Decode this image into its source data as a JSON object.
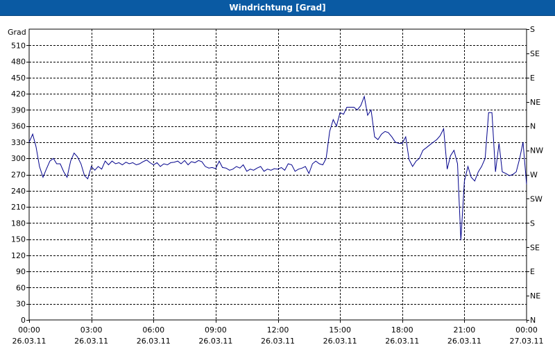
{
  "window": {
    "title": "Windrichtung [Grad]"
  },
  "chart_data": {
    "type": "line",
    "title": "Windrichtung [Grad]",
    "ylabel": "Grad",
    "xlabel": "",
    "ylim": [
      0,
      540
    ],
    "xlim": [
      0,
      24
    ],
    "grid": true,
    "y_ticks": [
      0,
      30,
      60,
      90,
      120,
      150,
      180,
      210,
      240,
      270,
      300,
      330,
      360,
      390,
      420,
      450,
      480,
      510
    ],
    "right_ticks": [
      {
        "value": 0,
        "label": "N"
      },
      {
        "value": 45,
        "label": "NE"
      },
      {
        "value": 90,
        "label": "E"
      },
      {
        "value": 135,
        "label": "SE"
      },
      {
        "value": 180,
        "label": "S"
      },
      {
        "value": 225,
        "label": "SW"
      },
      {
        "value": 270,
        "label": "W"
      },
      {
        "value": 315,
        "label": "NW"
      },
      {
        "value": 360,
        "label": "N"
      },
      {
        "value": 405,
        "label": "NE"
      },
      {
        "value": 450,
        "label": "E"
      },
      {
        "value": 495,
        "label": "SE"
      },
      {
        "value": 540,
        "label": "S"
      }
    ],
    "x_ticks": [
      {
        "value": 0,
        "time": "00:00",
        "date": "26.03.11"
      },
      {
        "value": 3,
        "time": "03:00",
        "date": "26.03.11"
      },
      {
        "value": 6,
        "time": "06:00",
        "date": "26.03.11"
      },
      {
        "value": 9,
        "time": "09:00",
        "date": "26.03.11"
      },
      {
        "value": 12,
        "time": "12:00",
        "date": "26.03.11"
      },
      {
        "value": 15,
        "time": "15:00",
        "date": "26.03.11"
      },
      {
        "value": 18,
        "time": "18:00",
        "date": "26.03.11"
      },
      {
        "value": 21,
        "time": "21:00",
        "date": "26.03.11"
      },
      {
        "value": 24,
        "time": "00:00",
        "date": "27.03.11"
      }
    ],
    "series": [
      {
        "color": "#00008b",
        "x": [
          0,
          0.17,
          0.33,
          0.5,
          0.67,
          0.83,
          1,
          1.17,
          1.33,
          1.5,
          1.67,
          1.83,
          2,
          2.17,
          2.33,
          2.5,
          2.67,
          2.83,
          3,
          3.17,
          3.33,
          3.5,
          3.67,
          3.83,
          4,
          4.17,
          4.33,
          4.5,
          4.67,
          4.83,
          5,
          5.17,
          5.33,
          5.5,
          5.67,
          5.83,
          6,
          6.17,
          6.33,
          6.5,
          6.67,
          6.83,
          7,
          7.17,
          7.33,
          7.5,
          7.67,
          7.83,
          8,
          8.17,
          8.33,
          8.5,
          8.67,
          8.83,
          9,
          9.17,
          9.33,
          9.5,
          9.67,
          9.83,
          10,
          10.17,
          10.33,
          10.5,
          10.67,
          10.83,
          11,
          11.17,
          11.33,
          11.5,
          11.67,
          11.83,
          12,
          12.17,
          12.33,
          12.5,
          12.67,
          12.83,
          13,
          13.17,
          13.33,
          13.5,
          13.67,
          13.83,
          14,
          14.17,
          14.33,
          14.5,
          14.67,
          14.83,
          15,
          15.17,
          15.33,
          15.5,
          15.67,
          15.83,
          16,
          16.17,
          16.33,
          16.5,
          16.67,
          16.83,
          17,
          17.17,
          17.33,
          17.5,
          17.67,
          17.83,
          18,
          18.17,
          18.33,
          18.5,
          18.67,
          18.83,
          19,
          19.17,
          19.33,
          19.5,
          19.67,
          19.83,
          20,
          20.17,
          20.33,
          20.5,
          20.67,
          20.83,
          21,
          21.17,
          21.33,
          21.5,
          21.67,
          21.83,
          22,
          22.17,
          22.33,
          22.5,
          22.67,
          22.83,
          23,
          23.17,
          23.33,
          23.5,
          23.67,
          23.83,
          24
        ],
        "y": [
          330,
          345,
          322,
          285,
          265,
          280,
          295,
          300,
          290,
          290,
          275,
          265,
          295,
          310,
          303,
          290,
          268,
          262,
          285,
          278,
          285,
          280,
          295,
          288,
          295,
          290,
          292,
          288,
          293,
          290,
          292,
          288,
          290,
          294,
          297,
          292,
          288,
          292,
          285,
          290,
          288,
          292,
          293,
          295,
          290,
          296,
          288,
          294,
          292,
          296,
          294,
          285,
          282,
          283,
          281,
          295,
          283,
          282,
          278,
          280,
          285,
          282,
          288,
          276,
          280,
          278,
          282,
          285,
          276,
          280,
          278,
          281,
          280,
          283,
          278,
          290,
          288,
          276,
          280,
          282,
          285,
          272,
          290,
          295,
          290,
          288,
          300,
          350,
          372,
          360,
          385,
          382,
          395,
          395,
          395,
          390,
          398,
          415,
          380,
          390,
          340,
          335,
          345,
          350,
          348,
          340,
          330,
          328,
          328,
          340,
          298,
          285,
          295,
          300,
          315,
          320,
          325,
          330,
          335,
          342,
          355,
          280,
          305,
          315,
          290,
          148,
          258,
          285,
          265,
          258,
          275,
          285,
          300,
          385,
          385,
          275,
          328,
          275,
          272,
          268,
          270,
          275,
          300,
          330,
          252
        ]
      }
    ]
  }
}
